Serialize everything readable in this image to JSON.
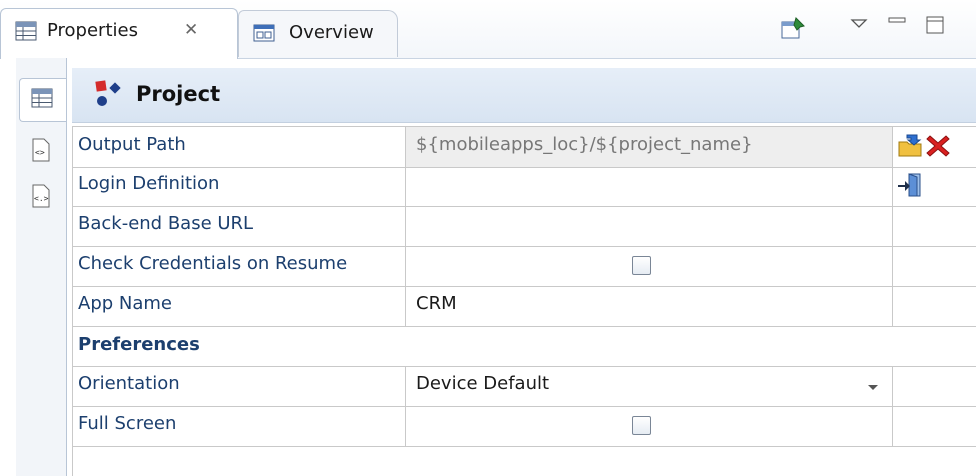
{
  "tabs": {
    "properties_label": "Properties",
    "overview_label": "Overview"
  },
  "header": {
    "title": "Project"
  },
  "rows": {
    "output_path": {
      "label": "Output Path",
      "value": "${mobileapps_loc}/${project_name}"
    },
    "login_definition": {
      "label": "Login Definition",
      "value": ""
    },
    "backend_base_url": {
      "label": "Back-end Base URL",
      "value": ""
    },
    "check_credentials": {
      "label": "Check Credentials on Resume",
      "checked": false
    },
    "app_name": {
      "label": "App Name",
      "value": "CRM"
    },
    "preferences_section": {
      "label": "Preferences"
    },
    "orientation": {
      "label": "Orientation",
      "value": "Device Default"
    },
    "full_screen": {
      "label": "Full Screen",
      "checked": false
    }
  },
  "icons": {
    "close_tab": "close-icon",
    "properties_tab": "table-icon",
    "overview_tab": "overview-icon",
    "pin": "pin-icon",
    "view_menu": "chevron-down-icon",
    "minimize": "minimize-icon",
    "maximize": "maximize-icon",
    "browse_folder": "folder-browse-icon",
    "delete": "delete-icon",
    "login_door": "door-enter-icon"
  },
  "colors": {
    "label_text": "#1c3f6e",
    "header_bg": "#dfe8f4",
    "delete_red": "#d92020",
    "accent_blue": "#1f4fa8"
  }
}
